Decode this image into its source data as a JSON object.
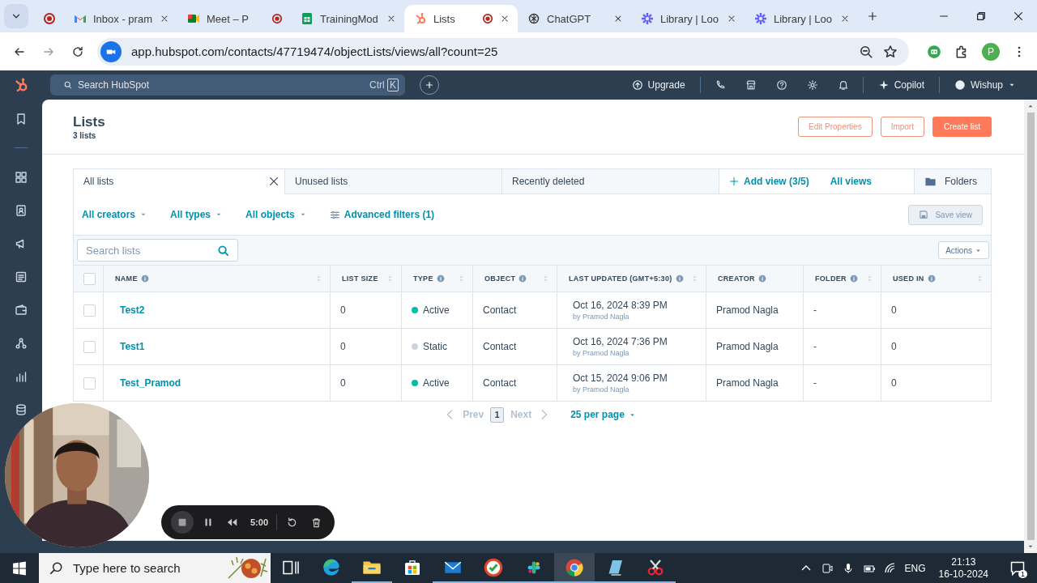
{
  "browser": {
    "tabs": [
      {
        "kind": "record",
        "recording": false,
        "closable": false,
        "selected": false
      },
      {
        "kind": "gmail",
        "title": "Inbox - pram",
        "recording": false,
        "closable": true,
        "selected": false
      },
      {
        "kind": "meet",
        "title": "Meet – P",
        "recording": true,
        "closable": false,
        "selected": false
      },
      {
        "kind": "sheets",
        "title": "TrainingMod",
        "recording": false,
        "closable": true,
        "selected": false
      },
      {
        "kind": "hubspot",
        "title": "Lists",
        "recording": true,
        "closable": true,
        "selected": true
      },
      {
        "kind": "chatgpt",
        "title": "ChatGPT",
        "recording": false,
        "closable": true,
        "selected": false
      },
      {
        "kind": "loom",
        "title": "Library | Loo",
        "recording": false,
        "closable": true,
        "selected": false
      },
      {
        "kind": "loom",
        "title": "Library | Loo",
        "recording": false,
        "closable": true,
        "selected": false
      }
    ],
    "url": "app.hubspot.com/contacts/47719474/objectLists/views/all?count=25",
    "profile": "P"
  },
  "app_bar": {
    "search_placeholder": "Search HubSpot",
    "shortcut": [
      "Ctrl",
      "K"
    ],
    "upgrade": "Upgrade",
    "copilot": "Copilot",
    "account": "Wishup"
  },
  "page": {
    "title": "Lists",
    "subtitle": "3 lists",
    "buttons": [
      {
        "label": "Edit Properties",
        "kind": "secondary"
      },
      {
        "label": "Import",
        "kind": "secondary"
      },
      {
        "label": "Create list",
        "kind": "primary"
      }
    ]
  },
  "view_tabs": [
    {
      "label": "All lists",
      "selected": true
    },
    {
      "label": "Unused lists",
      "selected": false
    },
    {
      "label": "Recently deleted",
      "selected": false
    }
  ],
  "add_view": "Add view (3/5)",
  "all_views": "All views",
  "folders": "Folders",
  "filters": [
    {
      "label": "All creators",
      "kind": "dropdown"
    },
    {
      "label": "All types",
      "kind": "dropdown"
    },
    {
      "label": "All objects",
      "kind": "dropdown"
    },
    {
      "label": "Advanced filters (1)",
      "kind": "advanced"
    }
  ],
  "save_view": {
    "label": "Save view",
    "disabled": true
  },
  "search": {
    "placeholder": "Search lists"
  },
  "actions": "Actions",
  "table": {
    "select_all": {
      "checked": false
    },
    "columns": [
      {
        "label": "NAME",
        "info": true,
        "sortable": true
      },
      {
        "label": "LIST SIZE",
        "info": false,
        "sortable": true
      },
      {
        "label": "TYPE",
        "info": true,
        "sortable": true
      },
      {
        "label": "OBJECT",
        "info": true,
        "sortable": true
      },
      {
        "label": "LAST UPDATED (GMT+5:30)",
        "info": true,
        "sortable": true
      },
      {
        "label": "CREATOR",
        "info": true,
        "sortable": false
      },
      {
        "label": "FOLDER",
        "info": true,
        "sortable": true
      },
      {
        "label": "USED IN",
        "info": true,
        "sortable": true
      }
    ],
    "rows": [
      {
        "checked": false,
        "name": "Test2",
        "size": "0",
        "type": "Active",
        "color": "#00bda5",
        "object": "Contact",
        "updated": "Oct 16, 2024 8:39 PM",
        "updated_by": "by Pramod Nagla",
        "creator": "Pramod Nagla",
        "folder": "-",
        "used_in": "0"
      },
      {
        "checked": false,
        "name": "Test1",
        "size": "0",
        "type": "Static",
        "color": "#cbd6e2",
        "object": "Contact",
        "updated": "Oct 16, 2024 7:36 PM",
        "updated_by": "by Pramod Nagla",
        "creator": "Pramod Nagla",
        "folder": "-",
        "used_in": "0"
      },
      {
        "checked": false,
        "name": "Test_Pramod",
        "size": "0",
        "type": "Active",
        "color": "#00bda5",
        "object": "Contact",
        "updated": "Oct 15, 2024 9:06 PM",
        "updated_by": "by Pramod Nagla",
        "creator": "Pramod Nagla",
        "folder": "-",
        "used_in": "0"
      }
    ]
  },
  "pagination": {
    "prev": "Prev",
    "pages": [
      {
        "label": "1",
        "selected": true
      }
    ],
    "next": "Next",
    "per_page": "25 per page"
  },
  "recorder": {
    "time": "5:00"
  },
  "taskbar": {
    "search_placeholder": "Type here to search",
    "apps": [
      {
        "kind": "taskview",
        "running": false,
        "selected": false
      },
      {
        "kind": "edge",
        "running": false,
        "selected": false
      },
      {
        "kind": "explorer",
        "running": true,
        "selected": false
      },
      {
        "kind": "store",
        "running": false,
        "selected": false
      },
      {
        "kind": "mail",
        "running": true,
        "selected": false
      },
      {
        "kind": "check",
        "running": true,
        "selected": false
      },
      {
        "kind": "slack",
        "running": true,
        "selected": false
      },
      {
        "kind": "chrome",
        "running": true,
        "selected": true
      },
      {
        "kind": "notes",
        "running": true,
        "selected": false
      },
      {
        "kind": "snip",
        "running": true,
        "selected": false
      }
    ],
    "language": "ENG",
    "time": "21:13",
    "date": "16-10-2024",
    "notifications": "1"
  }
}
